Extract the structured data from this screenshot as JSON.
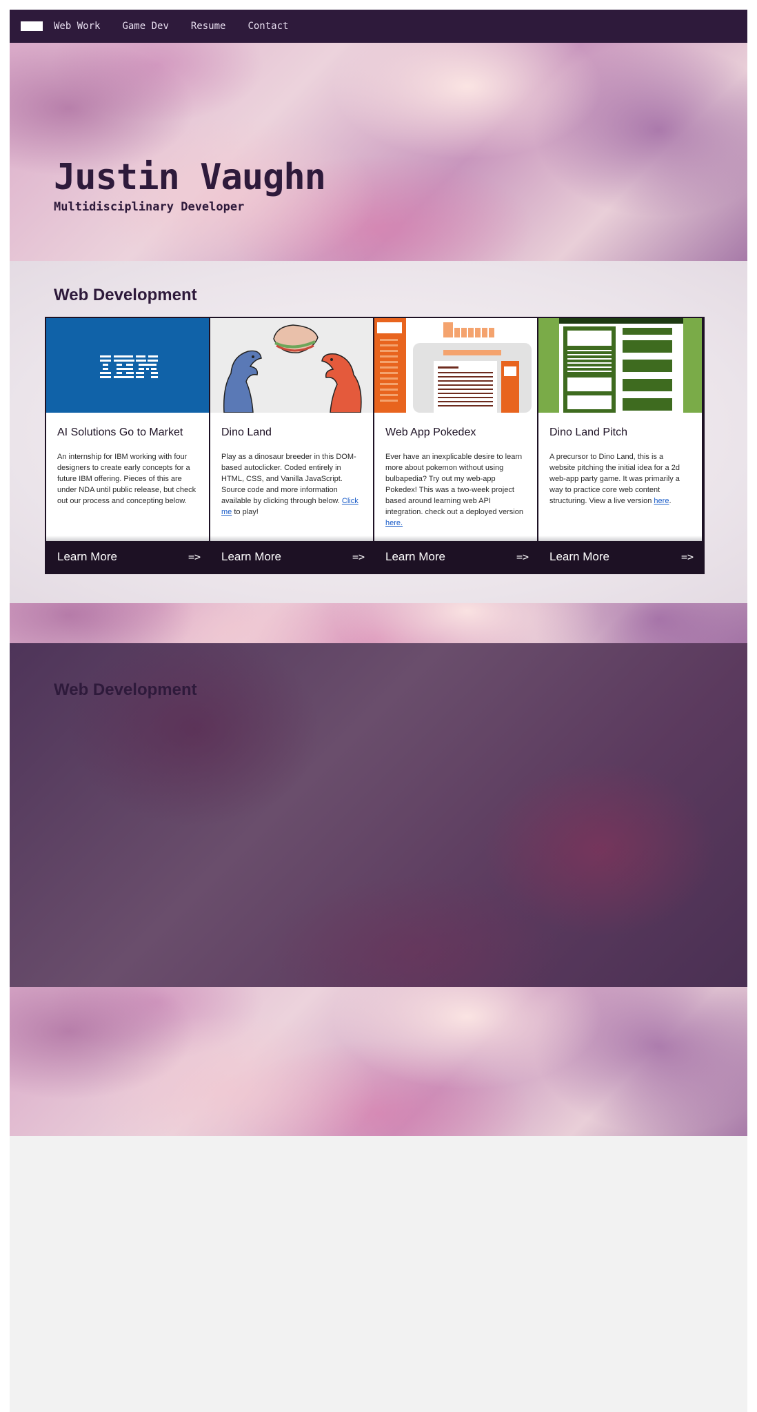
{
  "nav": {
    "links": [
      "Web Work",
      "Game Dev",
      "Resume",
      "Contact"
    ]
  },
  "hero": {
    "name": "Justin Vaughn",
    "subtitle": "Multidisciplinary Developer"
  },
  "webdev": {
    "title": "Web Development",
    "cards": [
      {
        "title": "AI Solutions Go to Market",
        "image": "ibm-logo",
        "image_text": "IBM",
        "desc": "An internship for IBM working with four designers to create early concepts for a future IBM offering. Pieces of this are under NDA until public release, but check out our process and concepting below.",
        "link_text": "",
        "desc_after": "",
        "button": "Learn More",
        "arrow": "=>"
      },
      {
        "title": "Dino Land",
        "image": "dino-sandwich-illustration",
        "desc": "Play as a dinosaur breeder in this DOM-based autoclicker. Coded entirely in HTML, CSS, and Vanilla JavaScript. Source code and more information available by clicking through below. ",
        "link_text": "Click me",
        "desc_after": " to play!",
        "button": "Learn More",
        "arrow": "=>"
      },
      {
        "title": "Web App Pokedex",
        "image": "pokedex-wireframe",
        "desc": "Ever have an inexplicable desire to learn more about pokemon without using bulbapedia? Try out my web-app Pokedex! This was a two-week project based around learning web API integration. check out a deployed version ",
        "link_text": "here.",
        "desc_after": "",
        "button": "Learn More",
        "arrow": "=>"
      },
      {
        "title": "Dino Land Pitch",
        "image": "pitch-site-wireframe",
        "desc": "A precursor to Dino Land, this is a website pitching the initial idea for a 2d web-app party game. It was primarily a way to practice core web content structuring. View a live version ",
        "link_text": "here",
        "desc_after": ".",
        "button": "Learn More",
        "arrow": "=>"
      }
    ]
  },
  "second_section": {
    "title": "Web Development"
  },
  "colors": {
    "nav": "#2e1a3b",
    "card_button": "#1d1124",
    "link": "#1a5cc8",
    "ibm_blue": "#1062a8"
  }
}
